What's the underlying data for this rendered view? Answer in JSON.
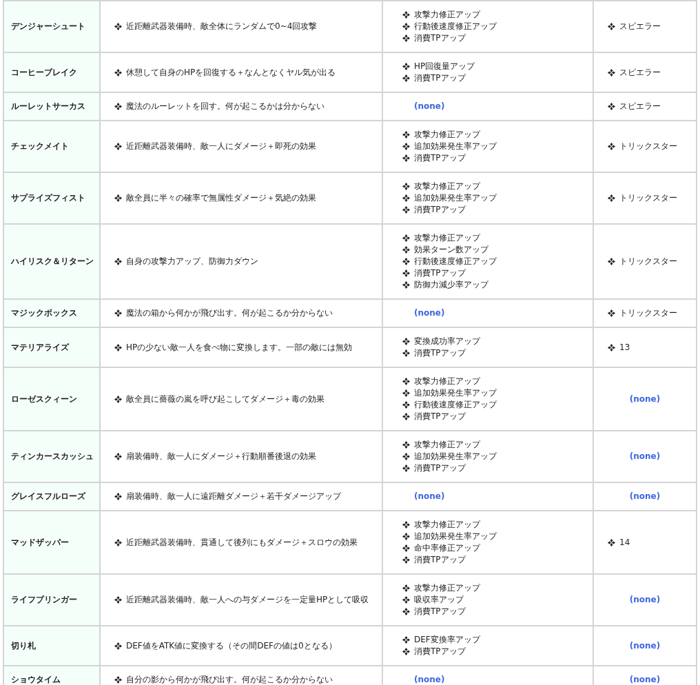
{
  "skills": [
    {
      "name": "デンジャーシュート",
      "effect": "近距離武器装備時、敵全体にランダムで0~4回攻撃",
      "upgrades": {
        "kind": "list",
        "items": [
          "攻撃力修正アップ",
          "行動後速度修正アップ",
          "消費TPアップ"
        ]
      },
      "column_4": {
        "kind": "list",
        "items": [
          "スピエラー"
        ]
      }
    },
    {
      "name": "コーヒーブレイク",
      "effect": "休憩して自身のHPを回復する＋なんとなくヤル気が出る",
      "upgrades": {
        "kind": "list",
        "items": [
          "HP回復量アップ",
          "消費TPアップ"
        ]
      },
      "column_4": {
        "kind": "list",
        "items": [
          "スピエラー"
        ]
      }
    },
    {
      "name": "ルーレットサーカス",
      "effect": "魔法のルーレットを回す。何が起こるかは分からない",
      "upgrades": {
        "kind": "none",
        "text": "(none)"
      },
      "column_4": {
        "kind": "list",
        "items": [
          "スピエラー"
        ]
      }
    },
    {
      "name": "チェックメイト",
      "effect": "近距離武器装備時、敵一人にダメージ＋即死の効果",
      "upgrades": {
        "kind": "list",
        "items": [
          "攻撃力修正アップ",
          "追加効果発生率アップ",
          "消費TPアップ"
        ]
      },
      "column_4": {
        "kind": "list",
        "items": [
          "トリックスター"
        ]
      }
    },
    {
      "name": "サプライズフィスト",
      "effect": "敵全員に半々の確率で無属性ダメージ＋気絶の効果",
      "upgrades": {
        "kind": "list",
        "items": [
          "攻撃力修正アップ",
          "追加効果発生率アップ",
          "消費TPアップ"
        ]
      },
      "column_4": {
        "kind": "list",
        "items": [
          "トリックスター"
        ]
      }
    },
    {
      "name": "ハイリスク＆リターン",
      "effect": "自身の攻撃力アップ、防御力ダウン",
      "upgrades": {
        "kind": "list",
        "items": [
          "攻撃力修正アップ",
          "効果ターン数アップ",
          "行動後速度修正アップ",
          "消費TPアップ",
          "防御力減少率アップ"
        ]
      },
      "column_4": {
        "kind": "list",
        "items": [
          "トリックスター"
        ]
      }
    },
    {
      "name": "マジックボックス",
      "effect": "魔法の箱から何かが飛び出す。何が起こるか分からない",
      "upgrades": {
        "kind": "none",
        "text": "(none)"
      },
      "column_4": {
        "kind": "list",
        "items": [
          "トリックスター"
        ]
      }
    },
    {
      "name": "マテリアライズ",
      "effect": "HPの少ない敵一人を食べ物に変換します。一部の敵には無効",
      "upgrades": {
        "kind": "list",
        "items": [
          "変換成功率アップ",
          "消費TPアップ"
        ]
      },
      "column_4": {
        "kind": "list",
        "items": [
          "13"
        ]
      }
    },
    {
      "name": "ローゼスクィーン",
      "effect": "敵全員に薔薇の嵐を呼び起こしてダメージ＋毒の効果",
      "upgrades": {
        "kind": "list",
        "items": [
          "攻撃力修正アップ",
          "追加効果発生率アップ",
          "行動後速度修正アップ",
          "消費TPアップ"
        ]
      },
      "column_4": {
        "kind": "none",
        "text": "(none)"
      }
    },
    {
      "name": "ティンカースカッシュ",
      "effect": "扇装備時、敵一人にダメージ＋行動順番後退の効果",
      "upgrades": {
        "kind": "list",
        "items": [
          "攻撃力修正アップ",
          "追加効果発生率アップ",
          "消費TPアップ"
        ]
      },
      "column_4": {
        "kind": "none",
        "text": "(none)"
      }
    },
    {
      "name": "グレイスフルローズ",
      "effect": "扇装備時、敵一人に遠距離ダメージ＋若干ダメージアップ",
      "upgrades": {
        "kind": "none",
        "text": "(none)"
      },
      "column_4": {
        "kind": "none",
        "text": "(none)"
      }
    },
    {
      "name": "マッドザッパー",
      "effect": "近距離武器装備時、貫通して後列にもダメージ＋スロウの効果",
      "upgrades": {
        "kind": "list",
        "items": [
          "攻撃力修正アップ",
          "追加効果発生率アップ",
          "命中率修正アップ",
          "消費TPアップ"
        ]
      },
      "column_4": {
        "kind": "list",
        "items": [
          "14"
        ]
      }
    },
    {
      "name": "ライフブリンガー",
      "effect": "近距離武器装備時、敵一人への与ダメージを一定量HPとして吸収",
      "upgrades": {
        "kind": "list",
        "items": [
          "攻撃力修正アップ",
          "吸収率アップ",
          "消費TPアップ"
        ]
      },
      "column_4": {
        "kind": "none",
        "text": "(none)"
      }
    },
    {
      "name": "切り札",
      "effect": "DEF値をATK値に変換する（その間DEFの値は0となる）",
      "upgrades": {
        "kind": "list",
        "items": [
          "DEF変換率アップ",
          "消費TPアップ"
        ]
      },
      "column_4": {
        "kind": "none",
        "text": "(none)"
      }
    },
    {
      "name": "ショウタイム",
      "effect": "自分の影から何かが飛び出す。何が起こるか分からない",
      "upgrades": {
        "kind": "none",
        "text": "(none)"
      },
      "column_4": {
        "kind": "none",
        "text": "(none)"
      }
    }
  ]
}
